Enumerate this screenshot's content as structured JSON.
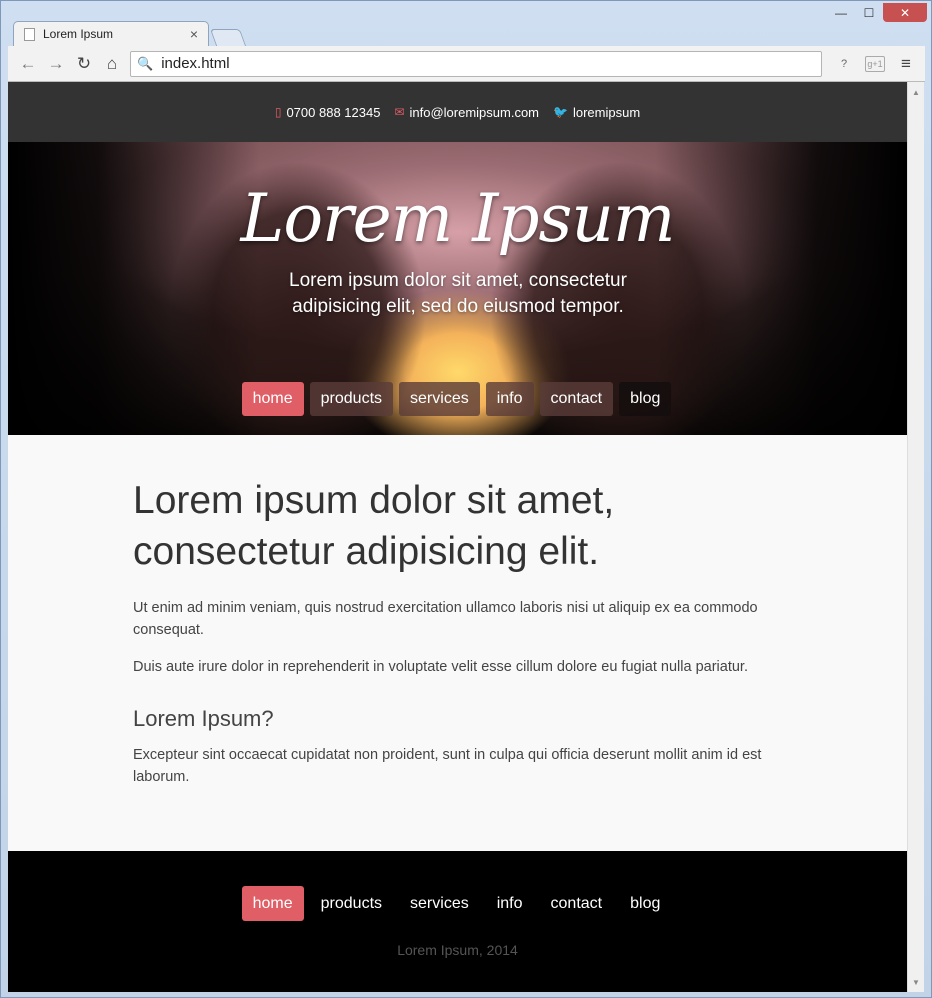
{
  "browser": {
    "tab_title": "Lorem Ipsum",
    "tab_close": "×",
    "address": "index.html",
    "win_minimize": "—",
    "win_maximize": "☐",
    "win_close": "✕"
  },
  "icons": {
    "back": "←",
    "forward": "→",
    "reload": "↻",
    "home": "⌂",
    "search": "🔍",
    "page_action": "?",
    "google_plus": "g+1",
    "menu": "≡",
    "phone": "▯",
    "mail": "✉",
    "twitter": "🐦",
    "scroll_up": "▲",
    "scroll_down": "▼"
  },
  "topbar": {
    "phone": "0700 888 12345",
    "email": "info@loremipsum.com",
    "twitter": "loremipsum"
  },
  "hero": {
    "title": "Lorem Ipsum",
    "tagline": "Lorem ipsum dolor sit amet, consectetur adipisicing elit, sed do eiusmod tempor."
  },
  "nav": {
    "items": [
      "home",
      "products",
      "services",
      "info",
      "contact",
      "blog"
    ],
    "active": "home"
  },
  "content": {
    "headline": "Lorem ipsum dolor sit amet, consectetur adipisicing elit.",
    "para1": "Ut enim ad minim veniam, quis nostrud exercitation ullamco laboris nisi ut aliquip ex ea commodo consequat.",
    "para2": "Duis aute irure dolor in reprehenderit in voluptate velit esse cillum dolore eu fugiat nulla pariatur.",
    "subhead": "Lorem Ipsum?",
    "para3": "Excepteur sint occaecat cupidatat non proident, sunt in culpa qui officia deserunt mollit anim id est laborum."
  },
  "footer": {
    "copyright": "Lorem Ipsum, 2014"
  },
  "colors": {
    "accent": "#e05e66",
    "topbar_bg": "#333333",
    "footer_bg": "#000000",
    "page_bg": "#f9f9f9"
  }
}
